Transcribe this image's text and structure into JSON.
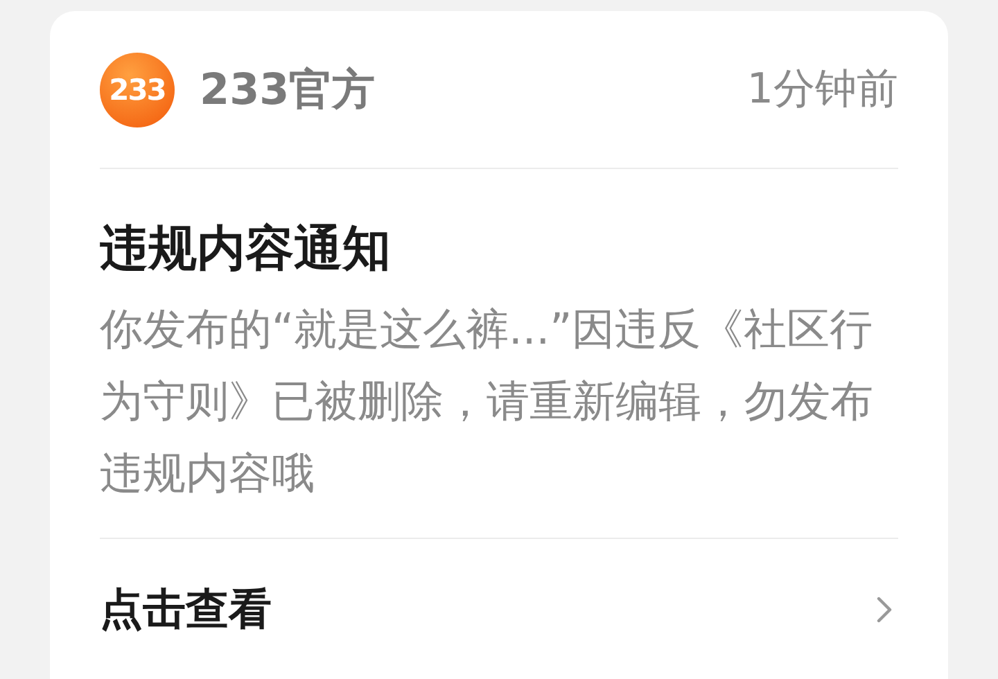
{
  "notification": {
    "sender": {
      "logo_text": "233",
      "name": "233官方"
    },
    "time": "1分钟前",
    "title": "违规内容通知",
    "body": "你发布的“就是这么裤...”因违反《社区行为守则》已被删除，请重新编辑，勿发布违规内容哦",
    "action": {
      "label": "点击查看"
    }
  }
}
